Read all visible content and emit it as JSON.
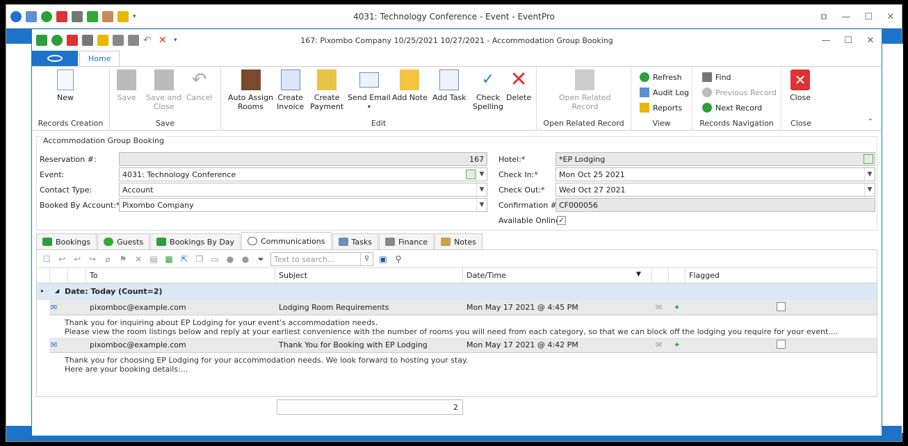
{
  "outer": {
    "title": "4031: Technology Conference - Event - EventPro"
  },
  "dialog": {
    "title": "167: Pixombo Company 10/25/2021 10/27/2021 - Accommodation Group Booking",
    "tab": "Home"
  },
  "ribbon": {
    "records_creation": {
      "label": "Records Creation",
      "new": "New"
    },
    "save": {
      "label": "Save",
      "save": "Save",
      "save_close_1": "Save and",
      "save_close_2": "Close",
      "cancel": "Cancel"
    },
    "edit": {
      "label": "Edit",
      "auto_1": "Auto Assign",
      "auto_2": "Rooms",
      "inv_1": "Create",
      "inv_2": "Invoice",
      "pay_1": "Create",
      "pay_2": "Payment",
      "email": "Send Email",
      "note": "Add Note",
      "task": "Add Task",
      "spell_1": "Check",
      "spell_2": "Spelling",
      "delete": "Delete"
    },
    "open_related": {
      "label": "Open Related Record",
      "btn_1": "Open Related",
      "btn_2": "Record"
    },
    "view": {
      "label": "View",
      "refresh": "Refresh",
      "audit": "Audit Log",
      "reports": "Reports"
    },
    "nav": {
      "label": "Records Navigation",
      "find": "Find",
      "prev": "Previous Record",
      "next": "Next Record"
    },
    "close": {
      "label": "Close",
      "btn": "Close"
    }
  },
  "form": {
    "section_title": "Accommodation Group Booking",
    "reservation_label": "Reservation #:",
    "reservation_value": "167",
    "event_label": "Event:",
    "event_value": "4031: Technology Conference",
    "contact_label": "Contact Type:",
    "contact_value": "Account",
    "booked_label": "Booked By Account:*",
    "booked_value": "Pixombo Company",
    "hotel_label": "Hotel:*",
    "hotel_value": "*EP Lodging",
    "checkin_label": "Check In:*",
    "checkin_value": "Mon Oct 25 2021",
    "checkout_label": "Check Out:*",
    "checkout_value": "Wed Oct 27 2021",
    "confirmation_label": "Confirmation #:",
    "confirmation_value": "CF000056",
    "online_label": "Available Online",
    "online_check": "✓"
  },
  "tabs": [
    "Bookings",
    "Guests",
    "Bookings By Day",
    "Communications",
    "Tasks",
    "Finance",
    "Notes"
  ],
  "grid": {
    "search_placeholder": "Text to search...",
    "columns": {
      "to": "To",
      "subject": "Subject",
      "datetime": "Date/Time",
      "flagged": "Flagged"
    },
    "group": "Date: Today (Count=2)",
    "rows": [
      {
        "to": "pixomboc@example.com",
        "subject": "Lodging Room Requirements",
        "datetime": "Mon May 17 2021 @ 4:45 PM",
        "preview_1": "Thank you for inquiring about EP Lodging for your event's accommodation needs.",
        "preview_2": "Please view the room listings below and reply at your earliest convenience with the number of rooms you will need from each category, so that we can block off the lodging you require for your event...."
      },
      {
        "to": "pixomboc@example.com",
        "subject": "Thank You for Booking with EP Lodging",
        "datetime": "Mon May 17 2021 @ 4:42 PM",
        "preview_1": "Thank you for choosing EP Lodging for your accommodation needs. We look forward to hosting your stay.",
        "preview_2": "Here are your booking details:..."
      }
    ],
    "count": "2"
  }
}
